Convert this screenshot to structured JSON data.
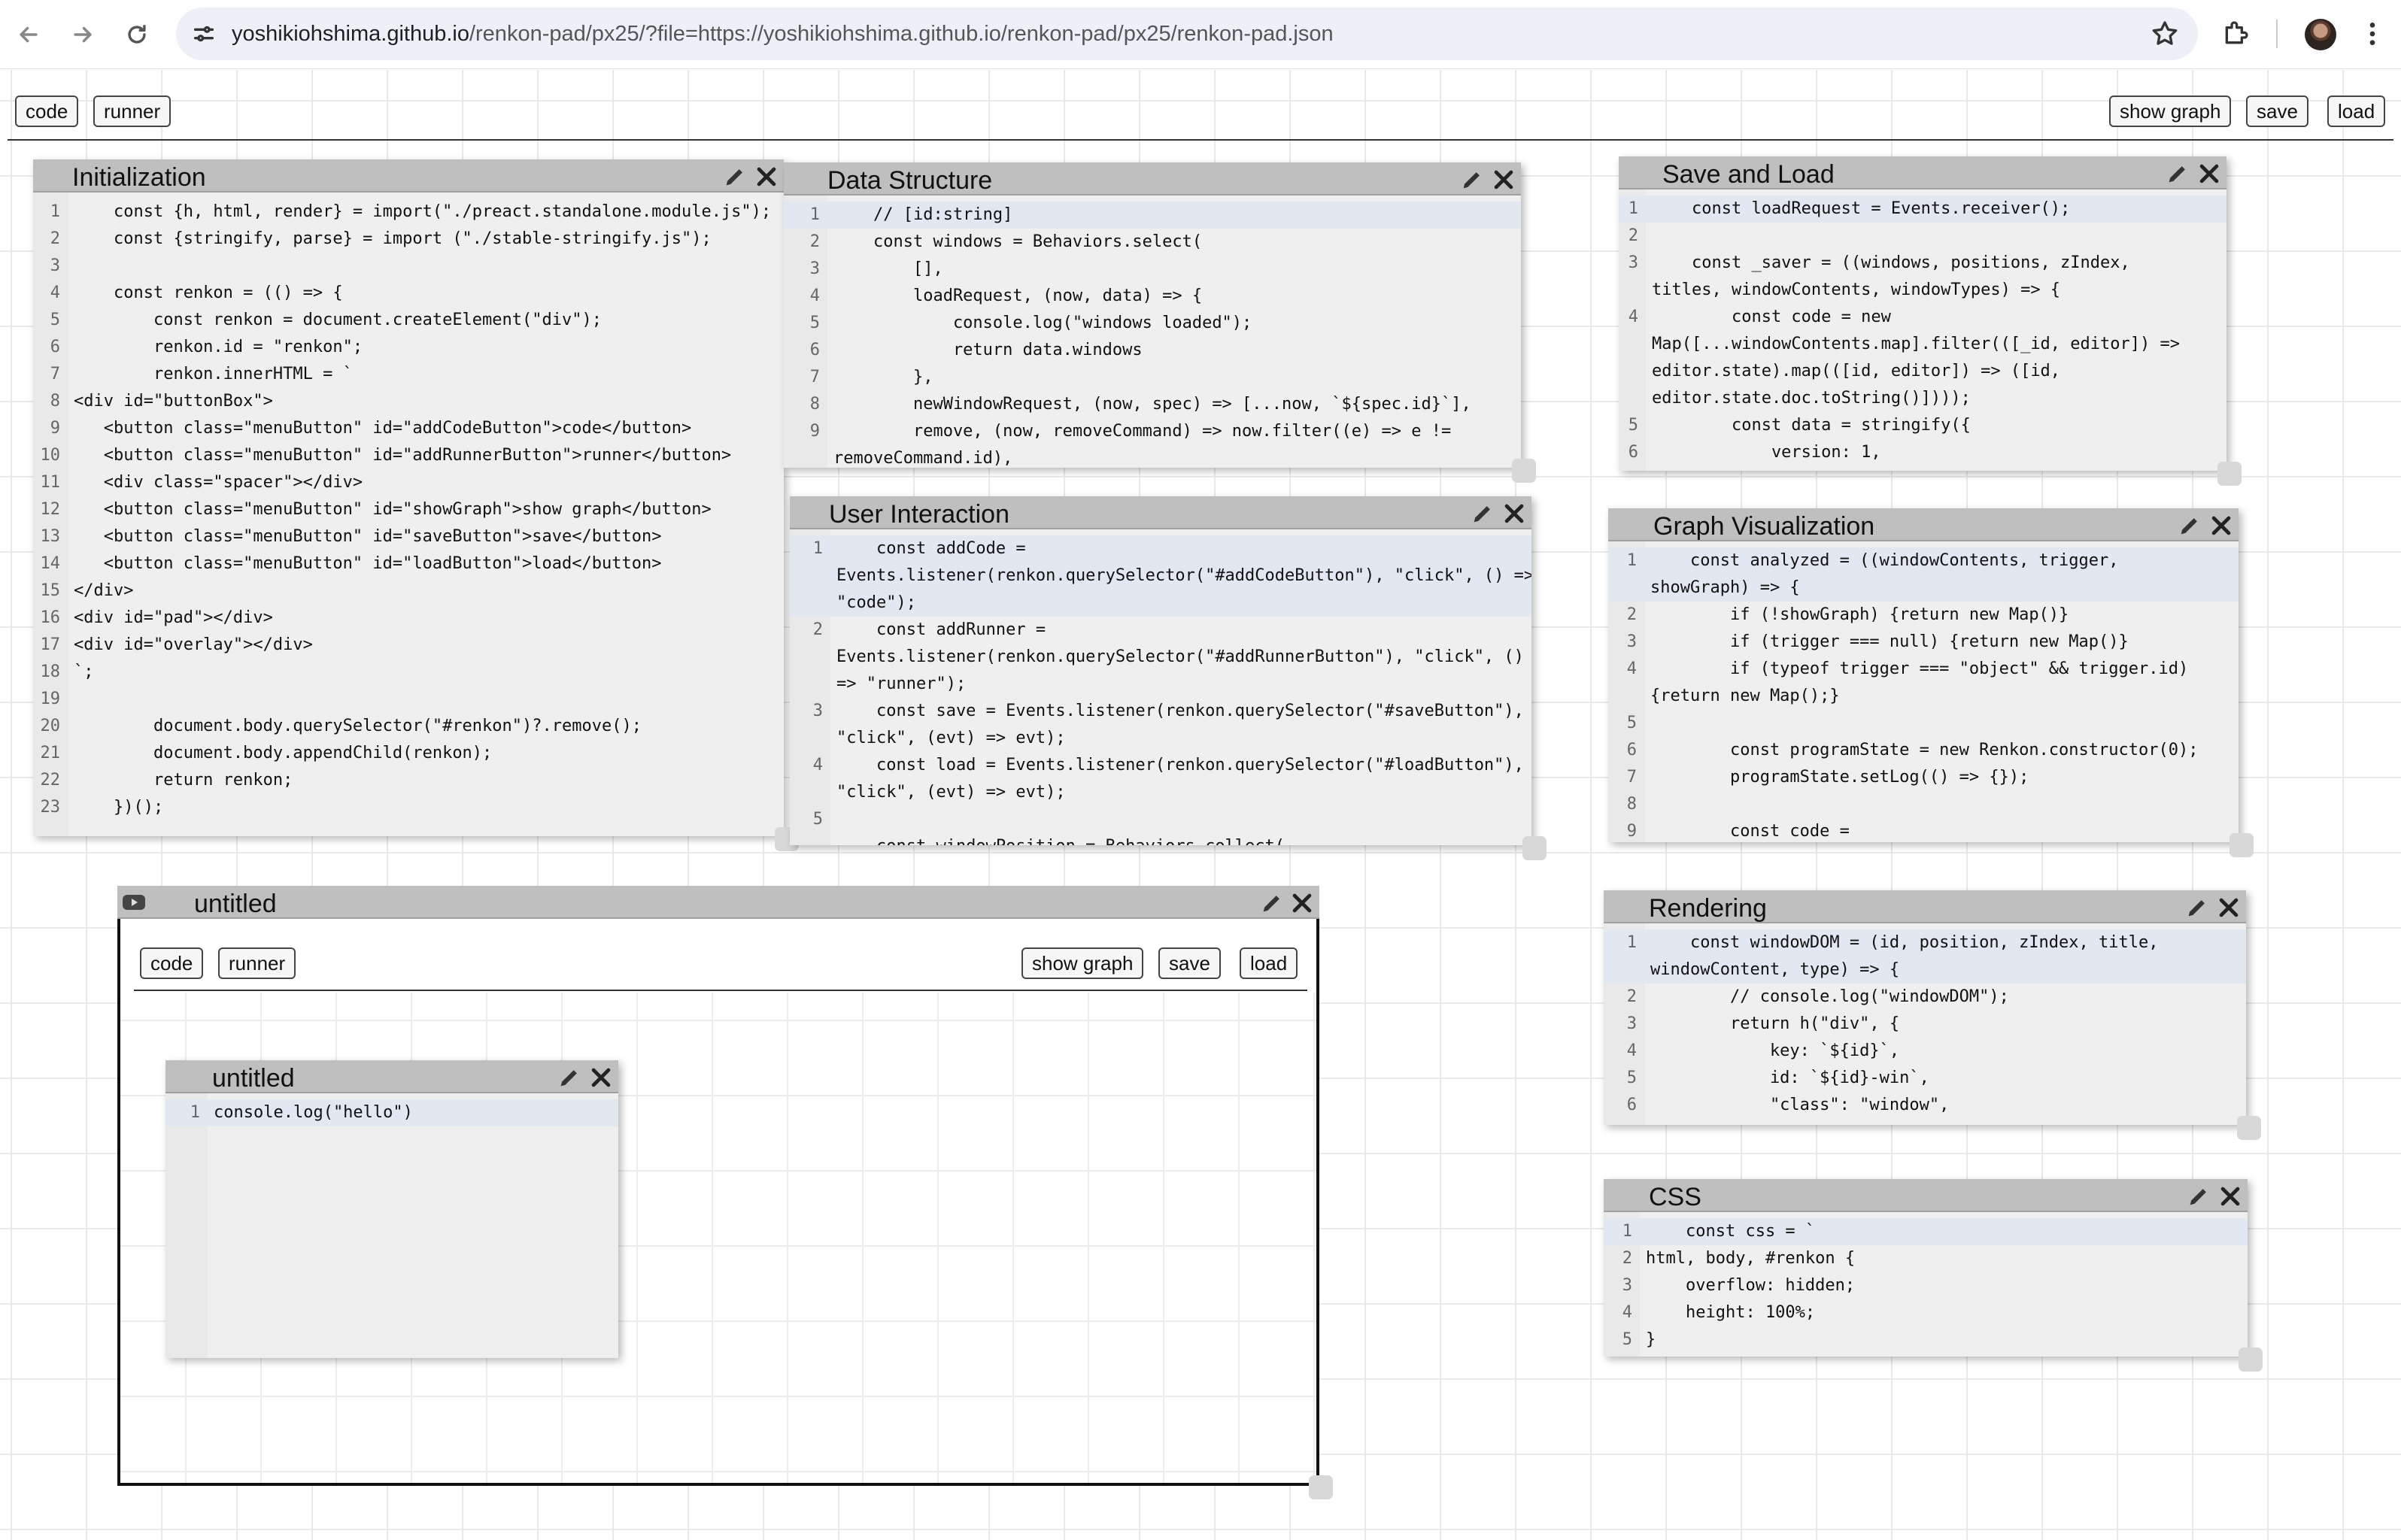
{
  "browser": {
    "url_host": "yoshikiohshima.github.io",
    "url_rest": "/renkon-pad/px25/?file=https://yoshikiohshima.github.io/renkon-pad/px25/renkon-pad.json"
  },
  "menu": {
    "code": "code",
    "runner": "runner",
    "show_graph": "show graph",
    "save": "save",
    "load": "load"
  },
  "windows": {
    "init": {
      "title": "Initialization",
      "lines": [
        "    const {h, html, render} = import(\"./preact.standalone.module.js\");",
        "    const {stringify, parse} = import (\"./stable-stringify.js\");",
        "",
        "    const renkon = (() => {",
        "        const renkon = document.createElement(\"div\");",
        "        renkon.id = \"renkon\";",
        "        renkon.innerHTML = `",
        "<div id=\"buttonBox\">",
        "   <button class=\"menuButton\" id=\"addCodeButton\">code</button>",
        "   <button class=\"menuButton\" id=\"addRunnerButton\">runner</button>",
        "   <div class=\"spacer\"></div>",
        "   <button class=\"menuButton\" id=\"showGraph\">show graph</button>",
        "   <button class=\"menuButton\" id=\"saveButton\">save</button>",
        "   <button class=\"menuButton\" id=\"loadButton\">load</button>",
        "</div>",
        "<div id=\"pad\"></div>",
        "<div id=\"overlay\"></div>",
        "`;",
        "",
        "        document.body.querySelector(\"#renkon\")?.remove();",
        "        document.body.appendChild(renkon);",
        "        return renkon;",
        "    })();"
      ],
      "nums": [
        "1",
        "2",
        "3",
        "4",
        "5",
        "6",
        "7",
        "8",
        "9",
        "10",
        "11",
        "12",
        "13",
        "14",
        "15",
        "16",
        "17",
        "18",
        "19",
        "20",
        "21",
        "22",
        "23"
      ]
    },
    "ds": {
      "title": "Data Structure",
      "lines": [
        "    // [id:string]",
        "    const windows = Behaviors.select(",
        "        [],",
        "        loadRequest, (now, data) => {",
        "            console.log(\"windows loaded\");",
        "            return data.windows",
        "        },",
        "        newWindowRequest, (now, spec) => [...now, `${spec.id}`],",
        "        remove, (now, removeCommand) => now.filter((e) => e !=",
        "removeCommand.id),"
      ],
      "nums": [
        "1",
        "2",
        "3",
        "4",
        "5",
        "6",
        "7",
        "8",
        "9",
        ""
      ]
    },
    "ui": {
      "title": "User Interaction",
      "lines": [
        "    const addCode =",
        "Events.listener(renkon.querySelector(\"#addCodeButton\"), \"click\", () =>",
        "\"code\");",
        "    const addRunner =",
        "Events.listener(renkon.querySelector(\"#addRunnerButton\"), \"click\", ()",
        "=> \"runner\");",
        "    const save = Events.listener(renkon.querySelector(\"#saveButton\"),",
        "\"click\", (evt) => evt);",
        "    const load = Events.listener(renkon.querySelector(\"#loadButton\"),",
        "\"click\", (evt) => evt);",
        "",
        "    const windowPosition = Behaviors.collect("
      ],
      "nums": [
        "1",
        "",
        "",
        "2",
        "",
        "",
        "3",
        "",
        "4",
        "",
        "5",
        ""
      ]
    },
    "sl": {
      "title": "Save and Load",
      "lines": [
        "    const loadRequest = Events.receiver();",
        "",
        "    const _saver = ((windows, positions, zIndex,",
        "titles, windowContents, windowTypes) => {",
        "        const code = new",
        "Map([...windowContents.map].filter(([_id, editor]) =>",
        "editor.state).map(([id, editor]) => ([id,",
        "editor.state.doc.toString()])));",
        "        const data = stringify({",
        "            version: 1,"
      ],
      "nums": [
        "1",
        "2",
        "3",
        "",
        "4",
        "",
        "",
        "",
        "5",
        "6"
      ]
    },
    "gv": {
      "title": "Graph Visualization",
      "lines": [
        "    const analyzed = ((windowContents, trigger,",
        "showGraph) => {",
        "        if (!showGraph) {return new Map()}",
        "        if (trigger === null) {return new Map()}",
        "        if (typeof trigger === \"object\" && trigger.id)",
        "{return new Map();}",
        "",
        "        const programState = new Renkon.constructor(0);",
        "        programState.setLog(() => {});",
        "",
        "        const code ="
      ],
      "nums": [
        "1",
        "",
        "2",
        "3",
        "4",
        "",
        "5",
        "6",
        "7",
        "8",
        "9"
      ]
    },
    "rd": {
      "title": "Rendering",
      "lines": [
        "    const windowDOM = (id, position, zIndex, title,",
        "windowContent, type) => {",
        "        // console.log(\"windowDOM\");",
        "        return h(\"div\", {",
        "            key: `${id}`,",
        "            id: `${id}-win`,",
        "            \"class\": \"window\","
      ],
      "nums": [
        "1",
        "",
        "2",
        "3",
        "4",
        "5",
        "6"
      ]
    },
    "css": {
      "title": "CSS",
      "lines": [
        "    const css = `",
        "html, body, #renkon {",
        "    overflow: hidden;",
        "    height: 100%;",
        "}"
      ],
      "nums": [
        "1",
        "2",
        "3",
        "4",
        "5"
      ]
    },
    "runner": {
      "title": "untitled"
    },
    "inner": {
      "title": "untitled",
      "lines": [
        "console.log(\"hello\")"
      ],
      "nums": [
        "1"
      ]
    }
  },
  "icons": [
    "back-arrow-icon",
    "forward-arrow-icon",
    "reload-icon",
    "site-settings-icon",
    "star-icon",
    "extensions-icon",
    "avatar",
    "menu-icon",
    "pencil-icon",
    "close-icon",
    "video-icon"
  ]
}
